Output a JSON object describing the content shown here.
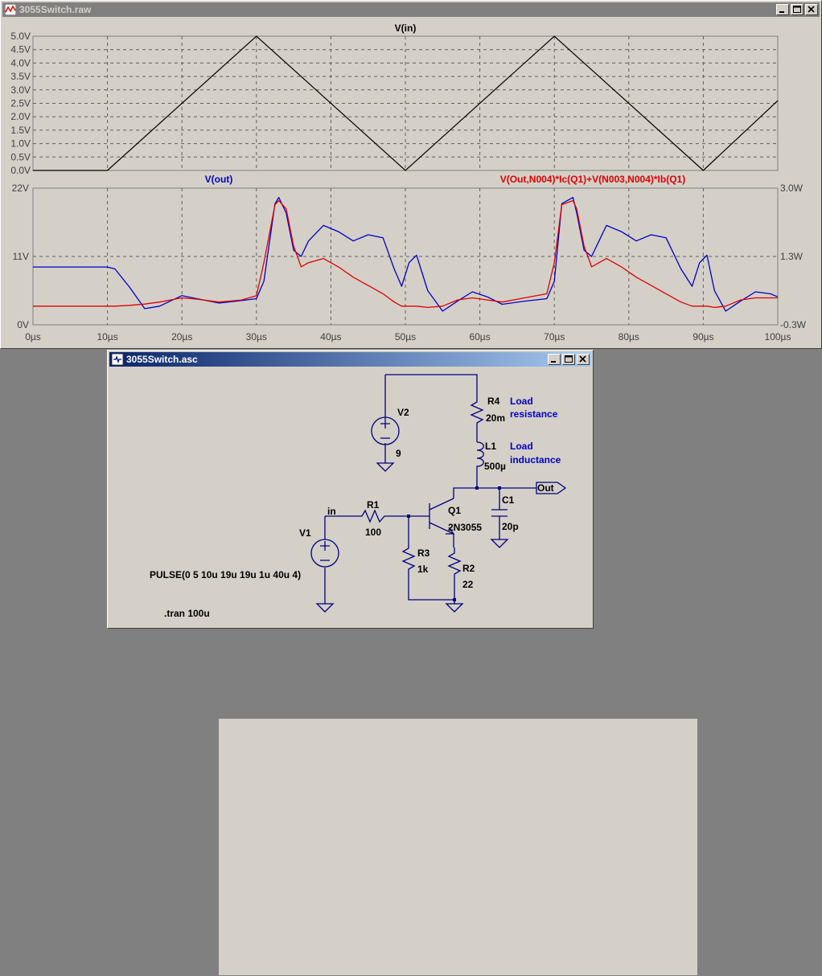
{
  "plot_window": {
    "title": "3055Switch.raw",
    "top_plot": {
      "label": "V(in)",
      "y_ticks": [
        "5.0V",
        "4.5V",
        "4.0V",
        "3.5V",
        "3.0V",
        "2.5V",
        "2.0V",
        "1.5V",
        "1.0V",
        "0.5V",
        "0.0V"
      ]
    },
    "bottom_plot": {
      "label_left": "V(out)",
      "label_right": "V(Out,N004)*Ic(Q1)+V(N003,N004)*Ib(Q1)",
      "y_ticks_left": [
        "22V",
        "11V",
        "0V"
      ],
      "y_ticks_right": [
        "3.0W",
        "1.3W",
        "-0.3W"
      ]
    },
    "x_ticks": [
      "0µs",
      "10µs",
      "20µs",
      "30µs",
      "40µs",
      "50µs",
      "60µs",
      "70µs",
      "80µs",
      "90µs",
      "100µs"
    ]
  },
  "chart_data": [
    {
      "type": "line",
      "title": "V(in)",
      "x": [
        0,
        10,
        30,
        50,
        70,
        90,
        100
      ],
      "series": [
        {
          "name": "V(in)",
          "values": [
            0,
            0,
            5,
            0,
            5,
            0,
            2.6
          ]
        }
      ],
      "xlim": [
        0,
        100
      ],
      "ylim": [
        0,
        5
      ],
      "xlabel": "",
      "ylabel": "",
      "colors": {
        "V(in)": "#000000"
      },
      "grid": true
    },
    {
      "type": "line",
      "x": [
        0,
        10,
        11,
        13,
        15,
        17,
        20,
        22,
        25,
        28,
        30,
        31,
        32.5,
        33,
        34,
        35,
        36,
        37,
        39,
        41,
        43,
        45,
        47,
        48.5,
        49.5,
        50.5,
        51.5,
        53,
        55,
        57,
        59,
        61,
        63,
        66,
        69,
        70,
        71,
        72.5,
        73,
        74,
        75,
        76,
        77,
        79,
        81,
        83,
        85,
        87,
        88.5,
        89.5,
        90.5,
        91.5,
        93,
        95,
        97,
        99,
        100
      ],
      "series": [
        {
          "name": "V(out)",
          "axis": "left",
          "values": [
            9.3,
            9.3,
            9.0,
            6.0,
            2.6,
            3.0,
            4.7,
            4.2,
            3.5,
            3.9,
            4.2,
            7.0,
            19.5,
            20.5,
            18.0,
            12.0,
            11.0,
            13.5,
            16.0,
            15.0,
            13.5,
            14.5,
            14.0,
            9.0,
            6.2,
            10.0,
            11.2,
            5.5,
            2.2,
            3.8,
            5.3,
            4.5,
            3.3,
            3.8,
            4.2,
            7.0,
            19.5,
            20.5,
            18.0,
            12.0,
            11.0,
            13.5,
            16.0,
            15.0,
            13.5,
            14.5,
            14.0,
            9.0,
            6.2,
            10.0,
            11.2,
            5.5,
            2.2,
            3.8,
            5.3,
            5.0,
            4.5
          ]
        },
        {
          "name": "V(Out,N004)*Ic(Q1)+V(N003,N004)*Ib(Q1)",
          "axis": "right",
          "values": [
            0.15,
            0.15,
            0.15,
            0.17,
            0.2,
            0.25,
            0.35,
            0.32,
            0.25,
            0.3,
            0.4,
            1.2,
            2.6,
            2.7,
            2.5,
            1.6,
            1.1,
            1.2,
            1.3,
            1.1,
            0.85,
            0.65,
            0.45,
            0.25,
            0.15,
            0.15,
            0.15,
            0.12,
            0.15,
            0.3,
            0.35,
            0.3,
            0.25,
            0.35,
            0.45,
            1.2,
            2.6,
            2.7,
            2.5,
            1.6,
            1.1,
            1.2,
            1.3,
            1.1,
            0.85,
            0.65,
            0.45,
            0.25,
            0.15,
            0.15,
            0.15,
            0.12,
            0.15,
            0.3,
            0.35,
            0.35,
            0.35
          ]
        }
      ],
      "xlim": [
        0,
        100
      ],
      "ylim_left": [
        0,
        22
      ],
      "ylim_right": [
        -0.3,
        3.0
      ],
      "colors": {
        "V(out)": "#0000c8",
        "V(Out,N004)*Ic(Q1)+V(N003,N004)*Ib(Q1)": "#e00000"
      },
      "grid": true
    }
  ],
  "schematic_window": {
    "title": "3055Switch.asc",
    "components": {
      "v2_name": "V2",
      "v2_value": "9",
      "r4_name": "R4",
      "r4_value": "20m",
      "l1_name": "L1",
      "l1_value": "500µ",
      "load_res_1": "Load",
      "load_res_2": "resistance",
      "load_ind_1": "Load",
      "load_ind_2": "inductance",
      "out_label": "Out",
      "c1_name": "C1",
      "c1_value": "20p",
      "q1_name": "Q1",
      "q1_value": "2N3055",
      "r1_name": "R1",
      "r1_value": "100",
      "in_label": "in",
      "v1_name": "V1",
      "r3_name": "R3",
      "r3_value": "1k",
      "r2_name": "R2",
      "r2_value": "22",
      "pulse": "PULSE(0 5 10u 19u 19u 1u 40u 4)",
      "tran": ".tran 100u"
    }
  }
}
